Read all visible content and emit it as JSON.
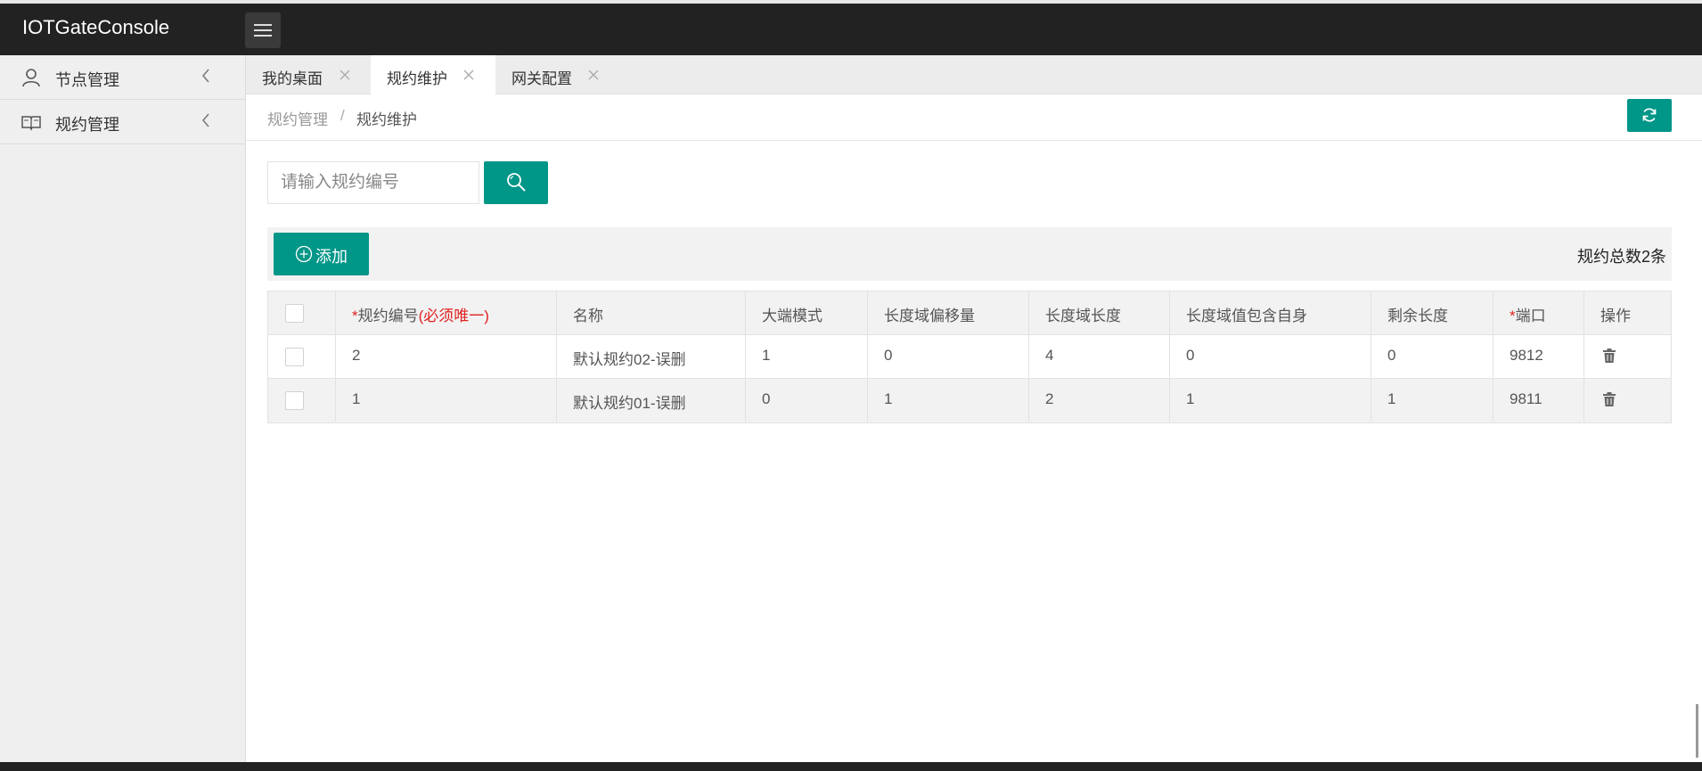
{
  "app": {
    "title": "IOTGateConsole"
  },
  "sidebar": {
    "items": [
      {
        "label": "节点管理",
        "icon": "user-icon"
      },
      {
        "label": "规约管理",
        "icon": "book-icon"
      }
    ]
  },
  "tabs": [
    {
      "label": "我的桌面",
      "active": false
    },
    {
      "label": "规约维护",
      "active": true
    },
    {
      "label": "网关配置",
      "active": false
    }
  ],
  "breadcrumb": {
    "parent": "规约管理",
    "separator": "/",
    "current": "规约维护"
  },
  "search": {
    "placeholder": "请输入规约编号",
    "value": ""
  },
  "toolbar": {
    "add_label": "添加",
    "total_text": "规约总数2条"
  },
  "table": {
    "headers": {
      "id_mark": "*",
      "id": "规约编号",
      "id_note": "(必须唯一)",
      "name": "名称",
      "endian": "大端模式",
      "len_offset": "长度域偏移量",
      "len_size": "长度域长度",
      "len_include_self": "长度域值包含自身",
      "remaining": "剩余长度",
      "port_mark": "*",
      "port": "端口",
      "action": "操作"
    },
    "rows": [
      {
        "id": "2",
        "name": "默认规约02-误删",
        "endian": "1",
        "len_offset": "0",
        "len_size": "4",
        "len_include_self": "0",
        "remaining": "0",
        "port": "9812"
      },
      {
        "id": "1",
        "name": "默认规约01-误删",
        "endian": "0",
        "len_offset": "1",
        "len_size": "2",
        "len_include_self": "1",
        "remaining": "1",
        "port": "9811"
      }
    ]
  },
  "colors": {
    "header_bg": "#222222",
    "accent": "#009688",
    "required": "#e02020",
    "sidebar_bg": "#efefef"
  }
}
